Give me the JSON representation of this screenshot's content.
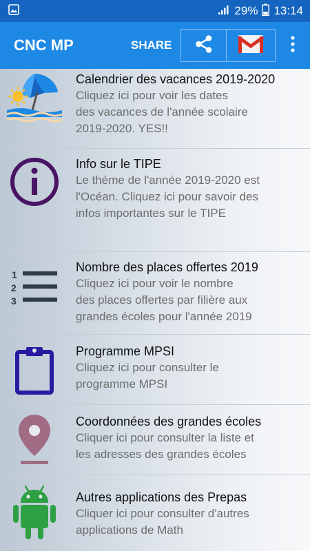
{
  "status_bar": {
    "battery": "29%",
    "time": "13:14"
  },
  "app_bar": {
    "title": "CNC MP",
    "share_label": "SHARE"
  },
  "items": [
    {
      "title": "Calendrier des vacances 2019-2020",
      "subtitle": "Cliquez ici pour voir les dates\ndes vacances de l'année scolaire\n2019-2020. YES!!",
      "icon": "beach-umbrella-icon"
    },
    {
      "title": "Info sur le TIPE",
      "subtitle": "Le thème de l'année 2019-2020 est\nl'Océan. Cliquez ici pour savoir des\ninfos importantes sur le TIPE",
      "icon": "info-icon"
    },
    {
      "title": "Nombre des places offertes 2019",
      "subtitle": "Cliquez ici pour voir le nombre\ndes places offertes par filière aux\ngrandes écoles pour l'année 2019",
      "icon": "numbered-list-icon"
    },
    {
      "title": "Programme MPSI",
      "subtitle": "Cliquez ici pour consulter le\nprogramme MPSI",
      "icon": "clipboard-icon"
    },
    {
      "title": "Coordonnées des grandes écoles",
      "subtitle": "Cliquer ici pour consulter la liste et\nles adresses des grandes écoles",
      "icon": "location-pin-icon"
    },
    {
      "title": "Autres applications des Prepas",
      "subtitle": "Cliquer ici pour consulter d'autres\napplications de Math",
      "icon": "android-icon"
    }
  ],
  "colors": {
    "status_bar": "#1565c0",
    "app_bar": "#1e88e5",
    "info_icon": "#4a1464",
    "list_icon": "#2e3d48",
    "clipboard_icon": "#2a1aa0",
    "pin_icon": "#a06b83",
    "android_icon": "#2ea043"
  }
}
